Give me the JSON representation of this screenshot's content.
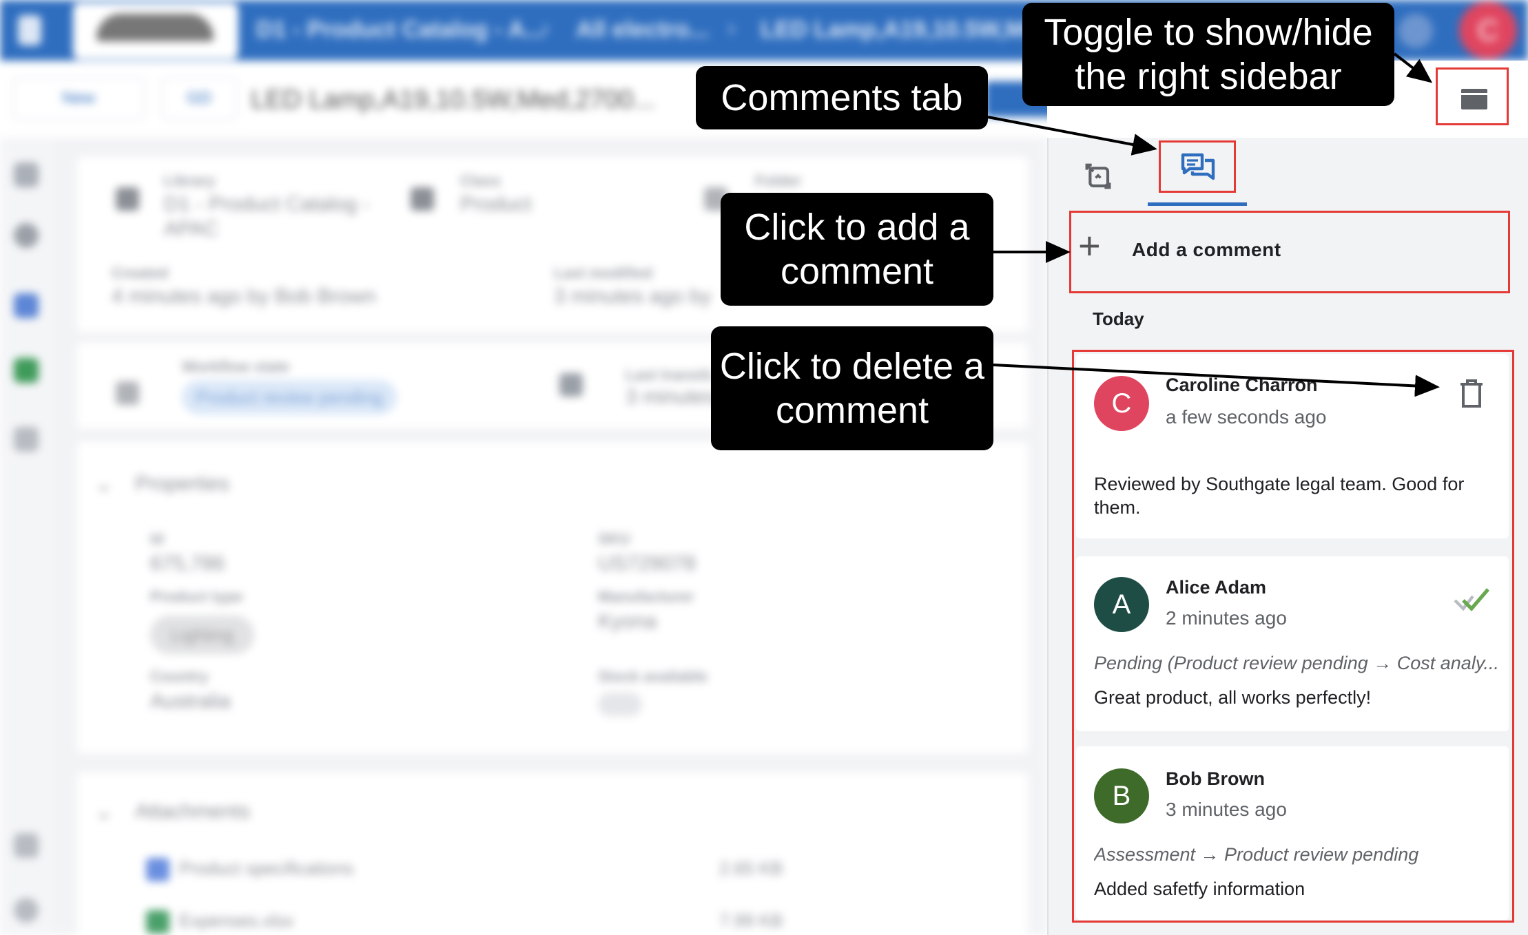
{
  "topbar": {
    "breadcrumb_1": "D1 - Product Catalog - A...",
    "breadcrumb_2": "All electro...",
    "breadcrumb_3": "LED Lamp,A19,10.5W,Me...",
    "avatar_initial": "C"
  },
  "toolbar": {
    "new_label": "New",
    "id_label": "GD",
    "document_title": "LED Lamp,A19,10.5W,Med,2700..."
  },
  "details": {
    "library_label": "Library",
    "library_value_1": "D1 - Product Catalog -",
    "library_value_2": "APAC",
    "class_label": "Class",
    "class_value": "Product",
    "folder_label": "Folder",
    "created_label": "Created",
    "created_value": "4 minutes ago by Bob Brown",
    "modified_label": "Last modified",
    "modified_value": "3 minutes ago by",
    "workflow_label": "Workflow state",
    "workflow_value": "Product review pending",
    "last_transition_label": "Last transiti...",
    "last_transition_value": "3 minutes",
    "properties_heading": "Properties",
    "id_field_label": "Id",
    "id_field_value": "675,786",
    "sku_label": "SKU",
    "sku_value": "US729078",
    "product_type_label": "Product type",
    "product_type_value": "Lighting",
    "manufacturer_label": "Manufacturer",
    "manufacturer_value": "Kyona",
    "country_label": "Country",
    "country_value": "Australia",
    "stock_label": "Stock available",
    "attachments_heading": "Attachments",
    "attachments": [
      {
        "name": "Product specifications",
        "size": "2.65 KB"
      },
      {
        "name": "Expenses.xlsx",
        "size": "7.99 KB"
      }
    ]
  },
  "sidebar": {
    "add_comment_label": "Add a comment",
    "group_label": "Today",
    "comments": [
      {
        "author": "Caroline Charron",
        "initial": "C",
        "time": "a few seconds ago",
        "workflow": "",
        "text": "Reviewed by Southgate legal team. Good for them.",
        "avatar_color": "#e0455f"
      },
      {
        "author": "Alice Adam",
        "initial": "A",
        "time": "2 minutes ago",
        "workflow": "Pending  (Product review pending → Cost analy...",
        "text": "Great product, all works perfectly!",
        "avatar_color": "#1e4d45"
      },
      {
        "author": "Bob Brown",
        "initial": "B",
        "time": "3 minutes ago",
        "workflow": "Assessment  → Product review pending",
        "text": "Added safetfy information",
        "avatar_color": "#3f6b2a"
      }
    ]
  },
  "callouts": {
    "toggle_sidebar": "Toggle to show/hide the right sidebar",
    "comments_tab": "Comments tab",
    "add_comment": "Click to add a comment",
    "delete_comment": "Click to delete a comment"
  },
  "colors": {
    "brand_blue": "#2f6ebf",
    "highlight_red": "#e53935",
    "callout_black": "#000000"
  },
  "icons": [
    "history-icon",
    "comments-icon",
    "plus-icon",
    "trash-icon",
    "check-icon",
    "panel-toggle-icon"
  ]
}
